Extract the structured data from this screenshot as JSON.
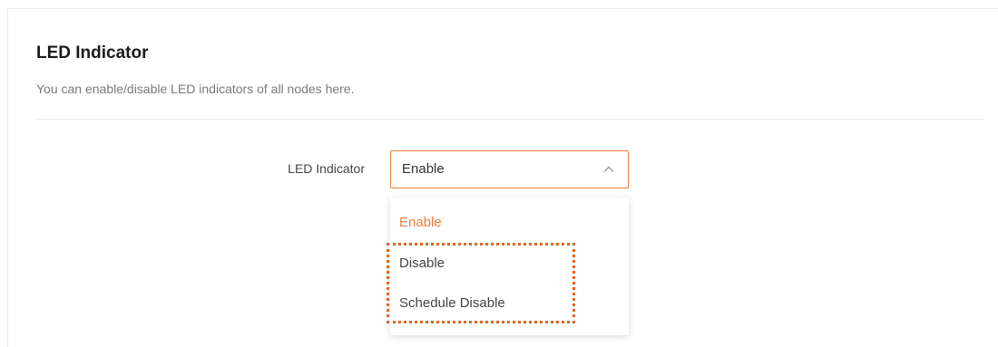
{
  "section": {
    "title": "LED Indicator",
    "description": "You can enable/disable LED indicators of all nodes here."
  },
  "form": {
    "led_field": {
      "label": "LED Indicator",
      "selected_value": "Enable",
      "expanded": true,
      "options": [
        {
          "label": "Enable",
          "selected": true
        },
        {
          "label": "Disable",
          "selected": false
        },
        {
          "label": "Schedule Disable",
          "selected": false
        }
      ]
    }
  },
  "colors": {
    "accent": "#f07c3a",
    "highlight_border": "#e0661e",
    "title_text": "#1a1a1a",
    "muted_text": "#7a7a7a",
    "divider": "#e6e6e6"
  },
  "icons": {
    "select_chevron": "chevron-up-icon"
  }
}
